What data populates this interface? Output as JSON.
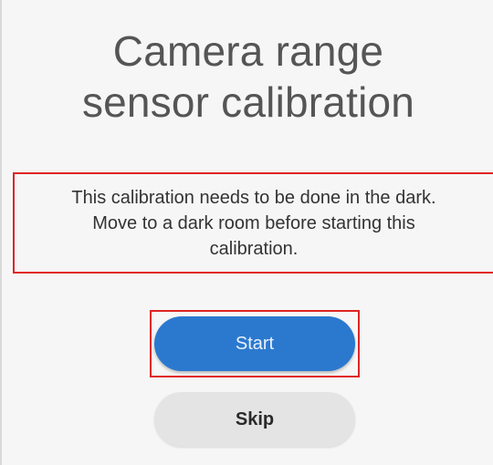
{
  "header": {
    "title_line1": "Camera range",
    "title_line2": "sensor calibration"
  },
  "main": {
    "message": "This calibration needs to be done in the dark. Move to a dark room before starting this calibration."
  },
  "actions": {
    "start_label": "Start",
    "skip_label": "Skip"
  },
  "colors": {
    "primary": "#2b79cf",
    "secondary": "#e4e4e4",
    "highlight": "#e02424",
    "background": "#f6f6f6"
  }
}
